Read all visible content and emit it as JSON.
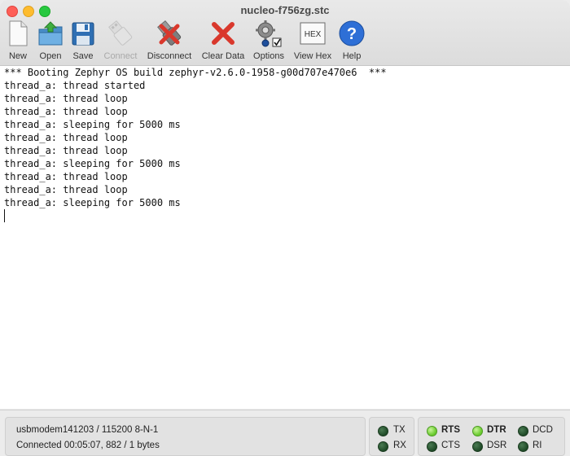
{
  "window": {
    "title": "nucleo-f756zg.stc"
  },
  "toolbar": {
    "new": "New",
    "open": "Open",
    "save": "Save",
    "connect": "Connect",
    "disconnect": "Disconnect",
    "clear_data": "Clear Data",
    "options": "Options",
    "view_hex": "View Hex",
    "hex_icon_text": "HEX",
    "help": "Help"
  },
  "terminal": {
    "lines": [
      "*** Booting Zephyr OS build zephyr-v2.6.0-1958-g00d707e470e6  ***",
      "thread_a: thread started",
      "thread_a: thread loop",
      "thread_a: thread loop",
      "thread_a: sleeping for 5000 ms",
      "thread_a: thread loop",
      "thread_a: thread loop",
      "thread_a: sleeping for 5000 ms",
      "thread_a: thread loop",
      "thread_a: thread loop",
      "thread_a: sleeping for 5000 ms"
    ]
  },
  "status": {
    "port": "usbmodem141203 / 115200 8-N-1",
    "connection": "Connected 00:05:07, 882 / 1 bytes",
    "leds": {
      "tx": {
        "label": "TX",
        "on": false
      },
      "rx": {
        "label": "RX",
        "on": false
      },
      "rts": {
        "label": "RTS",
        "on": true
      },
      "cts": {
        "label": "CTS",
        "on": false
      },
      "dtr": {
        "label": "DTR",
        "on": true
      },
      "dsr": {
        "label": "DSR",
        "on": false
      },
      "dcd": {
        "label": "DCD",
        "on": false
      },
      "ri": {
        "label": "RI",
        "on": false
      }
    }
  }
}
